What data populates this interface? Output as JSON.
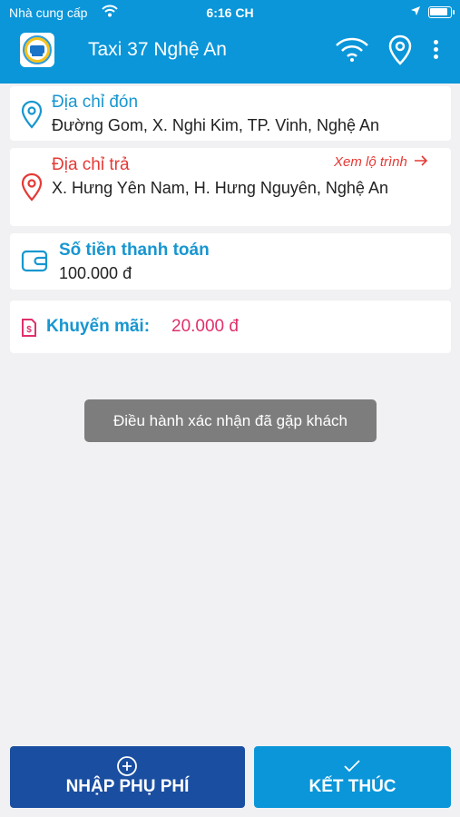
{
  "status_bar": {
    "carrier": "Nhà cung cấp",
    "time": "6:16 CH"
  },
  "app_bar": {
    "title": "Taxi 37 Nghệ An"
  },
  "pickup": {
    "label": "Địa chỉ đón",
    "address": "Đường Gom, X. Nghi Kim, TP. Vinh, Nghệ An"
  },
  "dropoff": {
    "label": "Địa chỉ trả",
    "route_link": "Xem lộ trình",
    "address": "X. Hưng Yên Nam, H. Hưng Nguyên, Nghệ An"
  },
  "payment": {
    "label": "Số tiền thanh toán",
    "amount": "100.000 đ"
  },
  "promotion": {
    "label": "Khuyến mãi:",
    "amount": "20.000 đ"
  },
  "toast": {
    "message": "Điều hành xác nhận đã gặp khách"
  },
  "actions": {
    "surcharge_label": "NHẬP PHỤ PHÍ",
    "finish_label": "KẾT THÚC"
  },
  "colors": {
    "primary": "#0a96d9",
    "surcharge_button": "#1a4ea0",
    "finish_button": "#0a96d9",
    "dropoff_label": "#e53935",
    "promotion": "#e0306a",
    "label_blue": "#1796d0",
    "toast": "#7d7d7d"
  }
}
